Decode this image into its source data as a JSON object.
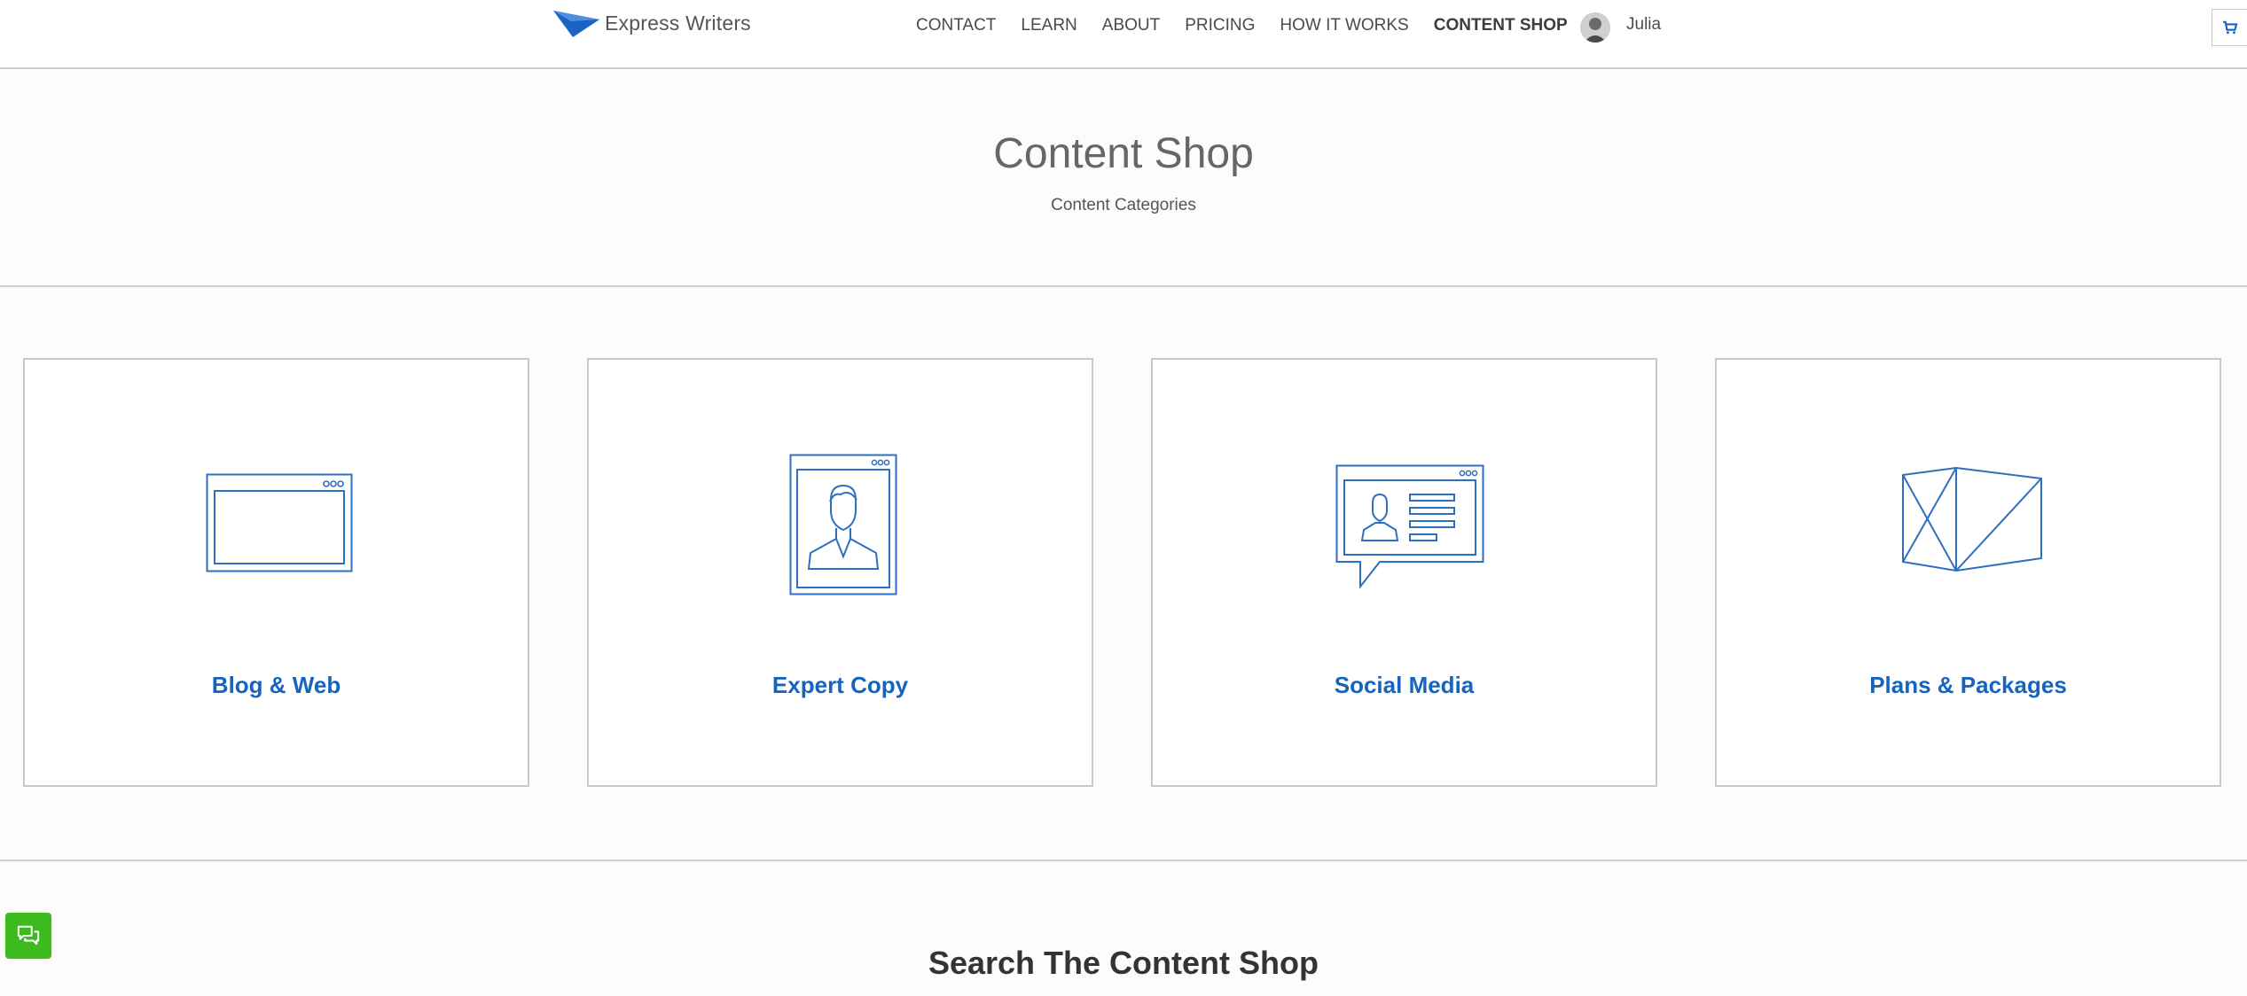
{
  "header": {
    "brand": "Express Writers",
    "nav": [
      "CONTACT",
      "LEARN",
      "ABOUT",
      "PRICING",
      "HOW IT WORKS",
      "CONTENT SHOP"
    ],
    "user_name": "Julia"
  },
  "hero": {
    "title": "Content Shop",
    "subtitle": "Content Categories"
  },
  "cards": [
    {
      "label": "Blog & Web",
      "icon": "browser-window-icon"
    },
    {
      "label": "Expert Copy",
      "icon": "profile-document-icon"
    },
    {
      "label": "Social Media",
      "icon": "chat-profile-icon"
    },
    {
      "label": "Plans & Packages",
      "icon": "package-box-icon"
    }
  ],
  "search": {
    "title": "Search The Content Shop"
  },
  "colors": {
    "accent": "#1565c0",
    "icon_stroke": "#2f6fc0",
    "chat_button": "#3dbb1d"
  }
}
